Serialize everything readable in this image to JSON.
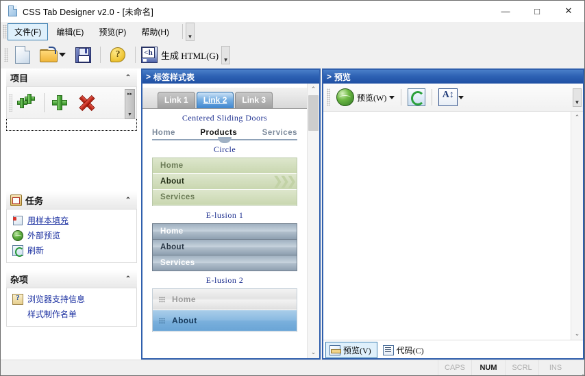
{
  "window": {
    "title": "CSS Tab Designer v2.0 - [未命名]",
    "icon": "document-icon",
    "minimize": "—",
    "maximize": "□",
    "close": "✕"
  },
  "menubar": {
    "items": [
      {
        "label": "文件(F)",
        "active": true
      },
      {
        "label": "编辑(E)",
        "active": false
      },
      {
        "label": "预览(P)",
        "active": false
      },
      {
        "label": "帮助(H)",
        "active": false
      }
    ],
    "overflow": "▼"
  },
  "toolbar": {
    "new_tooltip": "新建",
    "open_tooltip": "打开",
    "save_tooltip": "保存",
    "help_tooltip": "帮助",
    "generate_label": "生成 HTML(G)",
    "overflow": "▼"
  },
  "left_panel": {
    "project": {
      "title": "项目",
      "collapse": "⌃",
      "buttons": [
        {
          "name": "add-multiple",
          "label": "添加多项"
        },
        {
          "name": "add-one",
          "label": "添加"
        },
        {
          "name": "remove",
          "label": "删除"
        }
      ],
      "overflow": "▸▾"
    },
    "tasks": {
      "title": "任务",
      "collapse": "⌃",
      "links": [
        {
          "label": "用样本填充",
          "icon": "sample-fill-icon",
          "underline": true
        },
        {
          "label": "外部预览",
          "icon": "globe-icon",
          "underline": false
        },
        {
          "label": "刷新",
          "icon": "refresh-icon",
          "underline": false
        }
      ]
    },
    "misc": {
      "title": "杂项",
      "collapse": "⌃",
      "links": [
        {
          "label": "浏览器支持信息",
          "icon": "browser-info-icon",
          "indent": false
        },
        {
          "label": "样式制作名单",
          "icon": "",
          "indent": true
        }
      ]
    }
  },
  "center_panel": {
    "caption": "标签样式表",
    "caption_marker": ">",
    "styles": [
      {
        "name": "",
        "type": "sliding-doors",
        "tabs": [
          {
            "label": "Link 1",
            "selected": false
          },
          {
            "label": "Link 2",
            "selected": true
          },
          {
            "label": "Link 3",
            "selected": false
          }
        ]
      },
      {
        "name": "Centered Sliding Doors",
        "type": "centered-sliding-doors",
        "items": [
          {
            "label": "Home",
            "active": false
          },
          {
            "label": "Products",
            "active": true
          },
          {
            "label": "Services",
            "active": false
          }
        ]
      },
      {
        "name": "Circle",
        "type": "circle",
        "items": [
          {
            "label": "Home",
            "active": false
          },
          {
            "label": "About",
            "active": true
          },
          {
            "label": "Services",
            "active": false
          }
        ],
        "chevrons": "❯❯❯"
      },
      {
        "name": "E-lusion 1",
        "type": "elusion1",
        "items": [
          {
            "label": "Home",
            "active": false
          },
          {
            "label": "About",
            "active": true
          },
          {
            "label": "Services",
            "active": false
          }
        ]
      },
      {
        "name": "E-lusion 2",
        "type": "elusion2",
        "items": [
          {
            "label": "Home",
            "active": false
          },
          {
            "label": "About",
            "active": true
          }
        ]
      }
    ],
    "scroll": {
      "up": "⌃",
      "down": "⌄"
    }
  },
  "right_panel": {
    "caption": "预览",
    "caption_marker": ">",
    "toolbar": {
      "preview_label": "预览(W)",
      "preview_caret": "▾",
      "refresh_name": "refresh-icon",
      "font_label": "A",
      "font_caret": "▾",
      "overflow": "▼"
    },
    "tabs": [
      {
        "label": "预览(V)",
        "icon": "preview-icon",
        "selected": true
      },
      {
        "label": "代码(C)",
        "icon": "code-icon",
        "selected": false
      }
    ],
    "scroll": {
      "up": "⌃",
      "down": "⌄"
    }
  },
  "statusbar": {
    "message": "",
    "indicators": [
      {
        "label": "CAPS",
        "on": false
      },
      {
        "label": "NUM",
        "on": true
      },
      {
        "label": "SCRL",
        "on": false
      },
      {
        "label": "INS",
        "on": false
      }
    ]
  },
  "colors": {
    "pane_border": "#2f5fad",
    "caption_bg": "#2e62b4",
    "accent_select": "#dff0fb",
    "link": "#1a2fa0",
    "style_name": "#1d2f8f"
  }
}
